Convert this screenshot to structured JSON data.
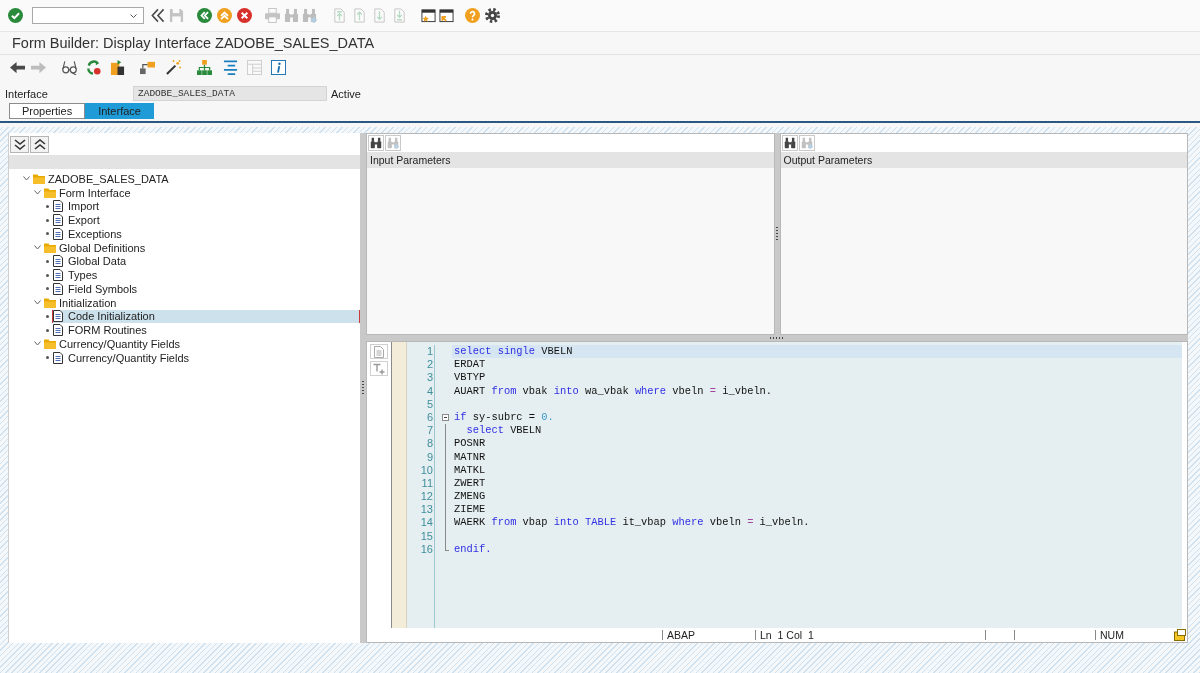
{
  "system_toolbar": [
    {
      "kind": "enter",
      "disabled": false
    },
    {
      "kind": "command_field"
    },
    {
      "kind": "collapse",
      "disabled": false
    },
    {
      "kind": "save",
      "disabled": true
    },
    {
      "kind": "back",
      "disabled": false
    },
    {
      "kind": "exit",
      "disabled": false
    },
    {
      "kind": "cancel",
      "disabled": false
    },
    {
      "kind": "print",
      "disabled": true
    },
    {
      "kind": "find",
      "disabled": true
    },
    {
      "kind": "find_next",
      "disabled": true
    },
    {
      "kind": "first_page",
      "disabled": true
    },
    {
      "kind": "prev_page",
      "disabled": true
    },
    {
      "kind": "next_page",
      "disabled": true
    },
    {
      "kind": "last_page",
      "disabled": true
    },
    {
      "kind": "new_session",
      "disabled": false
    },
    {
      "kind": "shortcut",
      "disabled": false
    },
    {
      "kind": "help",
      "disabled": false
    },
    {
      "kind": "customize",
      "disabled": false
    }
  ],
  "window": {
    "title": "Form Builder: Display Interface ZADOBE_SALES_DATA"
  },
  "application_toolbar": [
    {
      "kind": "back",
      "disabled": false
    },
    {
      "kind": "forward",
      "disabled": true
    },
    {
      "kind": "display_change",
      "disabled": false
    },
    {
      "kind": "activate",
      "disabled": false
    },
    {
      "kind": "check",
      "disabled": false
    },
    {
      "kind": "hierarchy",
      "disabled": false
    },
    {
      "kind": "wizard",
      "disabled": false
    },
    {
      "kind": "structure",
      "disabled": false
    },
    {
      "kind": "layout",
      "disabled": false
    },
    {
      "kind": "table",
      "disabled": true
    },
    {
      "kind": "info",
      "disabled": false
    }
  ],
  "header": {
    "label": "Interface",
    "value": "ZADOBE_SALES_DATA",
    "status": "Active"
  },
  "tabs": [
    {
      "label": "Properties",
      "selected": false
    },
    {
      "label": "Interface",
      "selected": true
    }
  ],
  "tree": [
    {
      "kind": "folder",
      "label": "ZADOBE_SALES_DATA",
      "expanded": true,
      "selected": false,
      "children": [
        {
          "kind": "folder",
          "label": "Form Interface",
          "expanded": true,
          "selected": false,
          "children": [
            {
              "kind": "document",
              "label": "Import",
              "selected": false
            },
            {
              "kind": "document",
              "label": "Export",
              "selected": false
            },
            {
              "kind": "document",
              "label": "Exceptions",
              "selected": false
            }
          ]
        },
        {
          "kind": "folder",
          "label": "Global Definitions",
          "expanded": true,
          "selected": false,
          "children": [
            {
              "kind": "document",
              "label": "Global Data",
              "selected": false
            },
            {
              "kind": "document",
              "label": "Types",
              "selected": false
            },
            {
              "kind": "document",
              "label": "Field Symbols",
              "selected": false
            }
          ]
        },
        {
          "kind": "folder",
          "label": "Initialization",
          "expanded": true,
          "selected": false,
          "children": [
            {
              "kind": "document",
              "label": "Code Initialization",
              "selected": true
            },
            {
              "kind": "document",
              "label": "FORM Routines",
              "selected": false
            }
          ]
        },
        {
          "kind": "folder",
          "label": "Currency/Quantity Fields",
          "expanded": true,
          "selected": false,
          "children": [
            {
              "kind": "document",
              "label": "Currency/Quantity Fields",
              "selected": false
            }
          ]
        }
      ]
    }
  ],
  "parameter_panes": [
    {
      "title": "Input Parameters",
      "buttons": [
        {
          "kind": "find",
          "disabled": false
        },
        {
          "kind": "find_next",
          "disabled": true
        }
      ]
    },
    {
      "title": "Output Parameters",
      "buttons": [
        {
          "kind": "find",
          "disabled": false
        },
        {
          "kind": "find_next",
          "disabled": true
        }
      ]
    }
  ],
  "editor": {
    "lines": [
      {
        "number": "1",
        "kind": "plain",
        "selected": true,
        "tokens": [
          {
            "kind": "keyword",
            "text": "select single"
          },
          {
            "kind": "plain",
            "text": " VBELN"
          }
        ]
      },
      {
        "number": "2",
        "kind": "plain",
        "selected": false,
        "tokens": [
          {
            "kind": "plain",
            "text": "ERDAT"
          }
        ]
      },
      {
        "number": "3",
        "kind": "plain",
        "selected": false,
        "tokens": [
          {
            "kind": "plain",
            "text": "VBTYP"
          }
        ]
      },
      {
        "number": "4",
        "kind": "plain",
        "selected": false,
        "tokens": [
          {
            "kind": "plain",
            "text": "AUART "
          },
          {
            "kind": "keyword",
            "text": "from"
          },
          {
            "kind": "plain",
            "text": " vbak "
          },
          {
            "kind": "keyword",
            "text": "into"
          },
          {
            "kind": "plain",
            "text": " wa_vbak "
          },
          {
            "kind": "keyword",
            "text": "where"
          },
          {
            "kind": "plain",
            "text": " vbeln "
          },
          {
            "kind": "operator",
            "text": "="
          },
          {
            "kind": "plain",
            "text": " i_vbeln."
          }
        ]
      },
      {
        "number": "5",
        "kind": "plain",
        "selected": false
      },
      {
        "number": "6",
        "kind": "fold_start",
        "selected": false,
        "tokens": [
          {
            "kind": "keyword",
            "text": "if"
          },
          {
            "kind": "plain",
            "text": " sy-subrc = "
          },
          {
            "kind": "number",
            "text": "0."
          }
        ]
      },
      {
        "number": "7",
        "kind": "fold_inner",
        "selected": false,
        "indented": true,
        "tokens": [
          {
            "kind": "keyword",
            "text": "select"
          },
          {
            "kind": "plain",
            "text": " VBELN"
          }
        ]
      },
      {
        "number": "8",
        "kind": "fold_inner",
        "selected": false,
        "tokens": [
          {
            "kind": "plain",
            "text": "POSNR"
          }
        ]
      },
      {
        "number": "9",
        "kind": "fold_inner",
        "selected": false,
        "tokens": [
          {
            "kind": "plain",
            "text": "MATNR"
          }
        ]
      },
      {
        "number": "10",
        "kind": "fold_inner",
        "selected": false,
        "tokens": [
          {
            "kind": "plain",
            "text": "MATKL"
          }
        ]
      },
      {
        "number": "11",
        "kind": "fold_inner",
        "selected": false,
        "tokens": [
          {
            "kind": "plain",
            "text": "ZWERT"
          }
        ]
      },
      {
        "number": "12",
        "kind": "fold_inner",
        "selected": false,
        "tokens": [
          {
            "kind": "plain",
            "text": "ZMENG"
          }
        ]
      },
      {
        "number": "13",
        "kind": "fold_inner",
        "selected": false,
        "tokens": [
          {
            "kind": "plain",
            "text": "ZIEME"
          }
        ]
      },
      {
        "number": "14",
        "kind": "fold_inner",
        "selected": false,
        "tokens": [
          {
            "kind": "plain",
            "text": "WAERK "
          },
          {
            "kind": "keyword",
            "text": "from"
          },
          {
            "kind": "plain",
            "text": " vbap "
          },
          {
            "kind": "keyword",
            "text": "into TABLE"
          },
          {
            "kind": "plain",
            "text": " it_vbap "
          },
          {
            "kind": "keyword",
            "text": "where"
          },
          {
            "kind": "plain",
            "text": " vbeln "
          },
          {
            "kind": "operator",
            "text": "="
          },
          {
            "kind": "plain",
            "text": " i_vbeln."
          }
        ]
      },
      {
        "number": "15",
        "kind": "fold_inner",
        "selected": false
      },
      {
        "number": "16",
        "kind": "fold_end",
        "selected": false,
        "tokens": [
          {
            "kind": "keyword",
            "text": "endif."
          }
        ]
      }
    ],
    "status_bar": {
      "language": "ABAP",
      "line_label": "Ln",
      "line": "1",
      "column_label": "Col",
      "column": "1",
      "mode": "NUM"
    }
  }
}
